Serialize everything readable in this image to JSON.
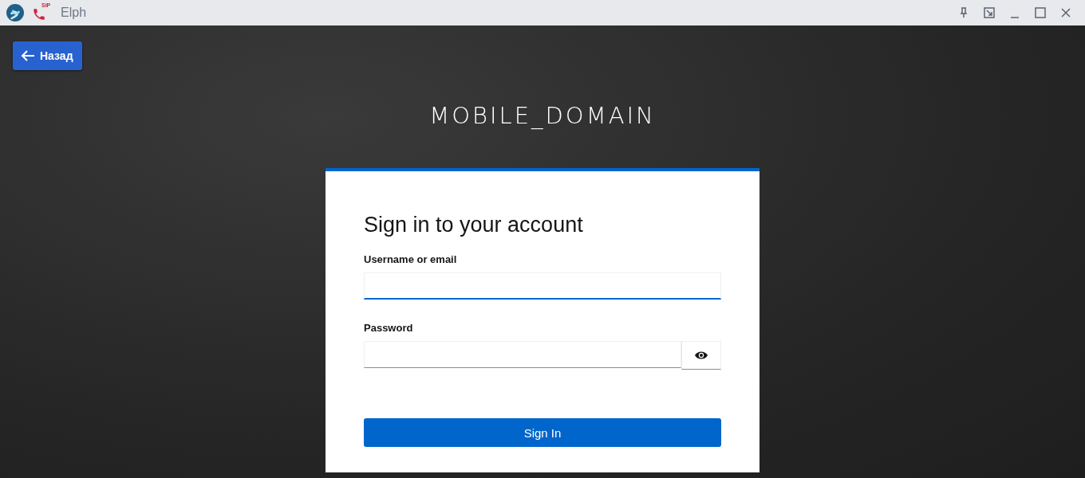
{
  "window": {
    "title": "Elph",
    "sip_label": "SIP"
  },
  "back_button": {
    "label": "Назад"
  },
  "realm_title": "MOBILE_DOMAIN",
  "login": {
    "heading": "Sign in to your account",
    "username": {
      "label": "Username or email",
      "focused": true
    },
    "password": {
      "label": "Password",
      "focused": false
    },
    "submit": "Sign In"
  }
}
